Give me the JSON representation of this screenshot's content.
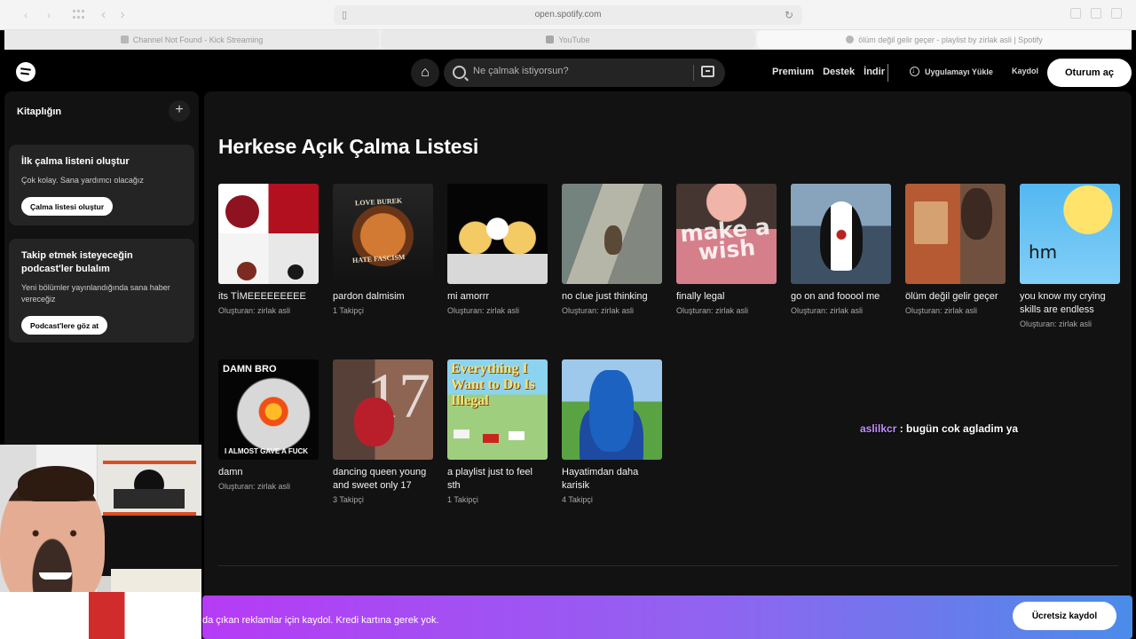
{
  "browser": {
    "url": "open.spotify.com",
    "tabs": [
      {
        "label": "Channel Not Found - Kick Streaming",
        "icon": "kick-icon"
      },
      {
        "label": "YouTube",
        "icon": "youtube-icon"
      },
      {
        "label": "ölüm değil gelir geçer - playlist by zirlak asli | Spotify",
        "icon": "spotify-icon"
      }
    ]
  },
  "header": {
    "search_placeholder": "Ne çalmak istiyorsun?",
    "links": [
      "Premium",
      "Destek",
      "İndir"
    ],
    "install": "Uygulamayı Yükle",
    "signup": "Kaydol",
    "login": "Oturum aç"
  },
  "sidebar": {
    "title": "Kitaplığın",
    "card1": {
      "title": "İlk çalma listeni oluştur",
      "desc": "Çok kolay. Sana yardımcı olacağız",
      "button": "Çalma listesi oluştur"
    },
    "card2": {
      "title": "Takip etmek isteyeceğin podcast'ler bulalım",
      "desc": "Yeni bölümler yayınlandığında sana haber vereceğiz",
      "button": "Podcast'lere göz at"
    }
  },
  "main": {
    "title": "Herkese Açık Çalma Listesi",
    "playlists": [
      {
        "title": "its TİMEEEEEEEEE",
        "subtitle": "Oluşturan: zirlak asli"
      },
      {
        "title": "pardon dalmisim",
        "subtitle": "1 Takipçi"
      },
      {
        "title": "mi amorrr",
        "subtitle": "Oluşturan: zirlak asli"
      },
      {
        "title": "no clue just thinking",
        "subtitle": "Oluşturan: zirlak asli"
      },
      {
        "title": "finally legal",
        "subtitle": "Oluşturan: zirlak asli"
      },
      {
        "title": "go on and fooool me",
        "subtitle": "Oluşturan: zirlak asli"
      },
      {
        "title": "ölüm değil gelir geçer",
        "subtitle": "Oluşturan: zirlak asli"
      },
      {
        "title": "you know my crying skills are endless",
        "subtitle": "Oluşturan: zirlak asli"
      },
      {
        "title": "damn",
        "subtitle": "Oluşturan: zirlak asli"
      },
      {
        "title": "dancing queen young and sweet only 17",
        "subtitle": "3 Takipçi"
      },
      {
        "title": "a playlist just to feel sth",
        "subtitle": "1 Takipçi"
      },
      {
        "title": "Hayatimdan daha karisik",
        "subtitle": "4 Takipçi"
      }
    ]
  },
  "chat": {
    "user": "aslilkcr",
    "message": " : bugün cok agladim ya"
  },
  "banner": {
    "text": "da çıkan reklamlar için kaydol. Kredi kartına gerek yok.",
    "button": "Ücretsiz kaydol"
  }
}
